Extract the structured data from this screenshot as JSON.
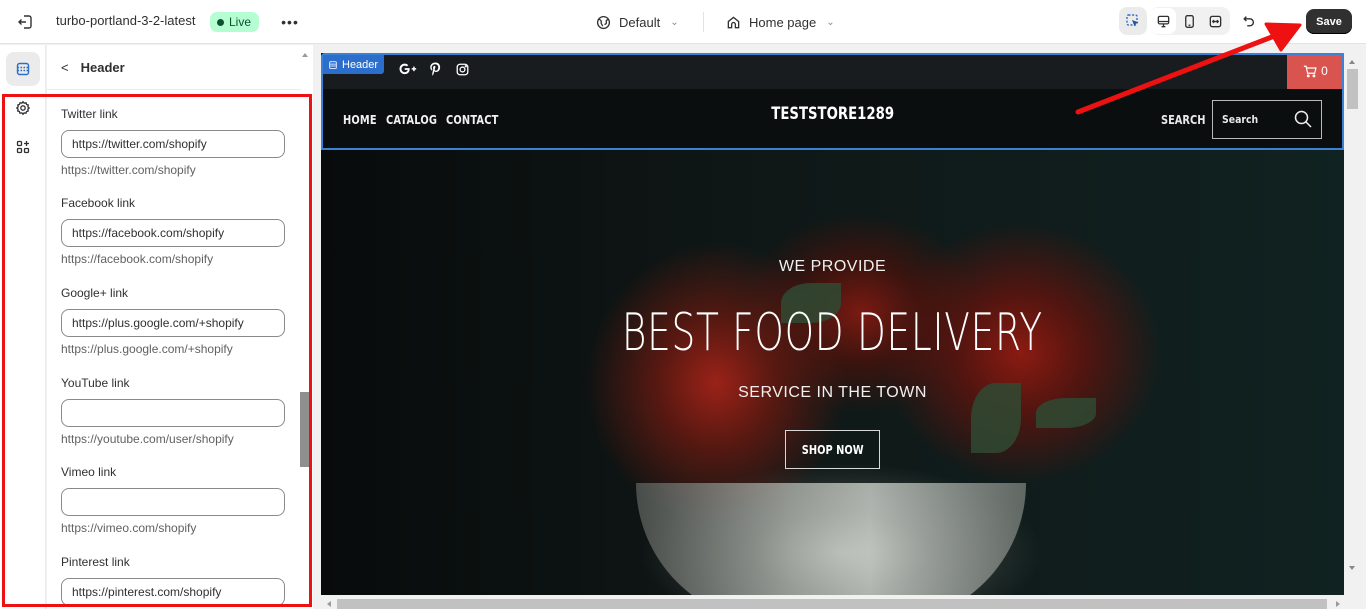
{
  "topbar": {
    "store_name": "turbo-portland-3-2-latest",
    "status_badge": "Live",
    "more_label": "•••",
    "theme_dropdown": "Default",
    "page_dropdown": "Home page",
    "save_label": "Save",
    "icons": {
      "exit": "exit-icon",
      "globe": "globe-icon",
      "home": "home-icon",
      "inspector": "select-inspector-icon",
      "desktop": "desktop-icon",
      "mobile": "mobile-icon",
      "fullscreen": "fullscreen-icon",
      "undo": "undo-icon"
    },
    "colors": {
      "live_bg": "#b4fed2",
      "live_text": "#0c5132",
      "save_bg": "#303030"
    }
  },
  "rail": {
    "items": [
      {
        "name": "sections",
        "icon": "sections-icon",
        "active": true
      },
      {
        "name": "theme-settings",
        "icon": "gear-icon",
        "active": false
      },
      {
        "name": "apps",
        "icon": "apps-icon",
        "active": false
      }
    ]
  },
  "panel": {
    "back_label": "<",
    "title": "Header",
    "fields": [
      {
        "label": "Twitter link",
        "value": "https://twitter.com/shopify",
        "hint": "https://twitter.com/shopify"
      },
      {
        "label": "Facebook link",
        "value": "https://facebook.com/shopify",
        "hint": "https://facebook.com/shopify"
      },
      {
        "label": "Google+ link",
        "value": "https://plus.google.com/+shopify",
        "hint": "https://plus.google.com/+shopify"
      },
      {
        "label": "YouTube link",
        "value": "",
        "hint": "https://youtube.com/user/shopify"
      },
      {
        "label": "Vimeo link",
        "value": "",
        "hint": "https://vimeo.com/shopify"
      },
      {
        "label": "Pinterest link",
        "value": "https://pinterest.com/shopify",
        "hint": ""
      }
    ]
  },
  "preview": {
    "section_tag": "Header",
    "social_icons": [
      "google-plus-icon",
      "pinterest-icon",
      "instagram-icon"
    ],
    "cart_count": "0",
    "nav": [
      "HOME",
      "CATALOG",
      "CONTACT"
    ],
    "store_logo": "TESTSTORE1289",
    "search_label": "SEARCH",
    "search_placeholder": "Search",
    "hero": {
      "pretitle": "WE PROVIDE",
      "title": "BEST FOOD DELIVERY",
      "subtitle": "SERVICE IN THE TOWN",
      "button": "SHOP NOW"
    },
    "colors": {
      "cart_bg": "#d9534f",
      "selection": "#3b82d6",
      "header_bg": "#0b0e0e"
    }
  },
  "annotation": {
    "highlight_color": "#ee1111",
    "arrow_target": "save-button"
  }
}
